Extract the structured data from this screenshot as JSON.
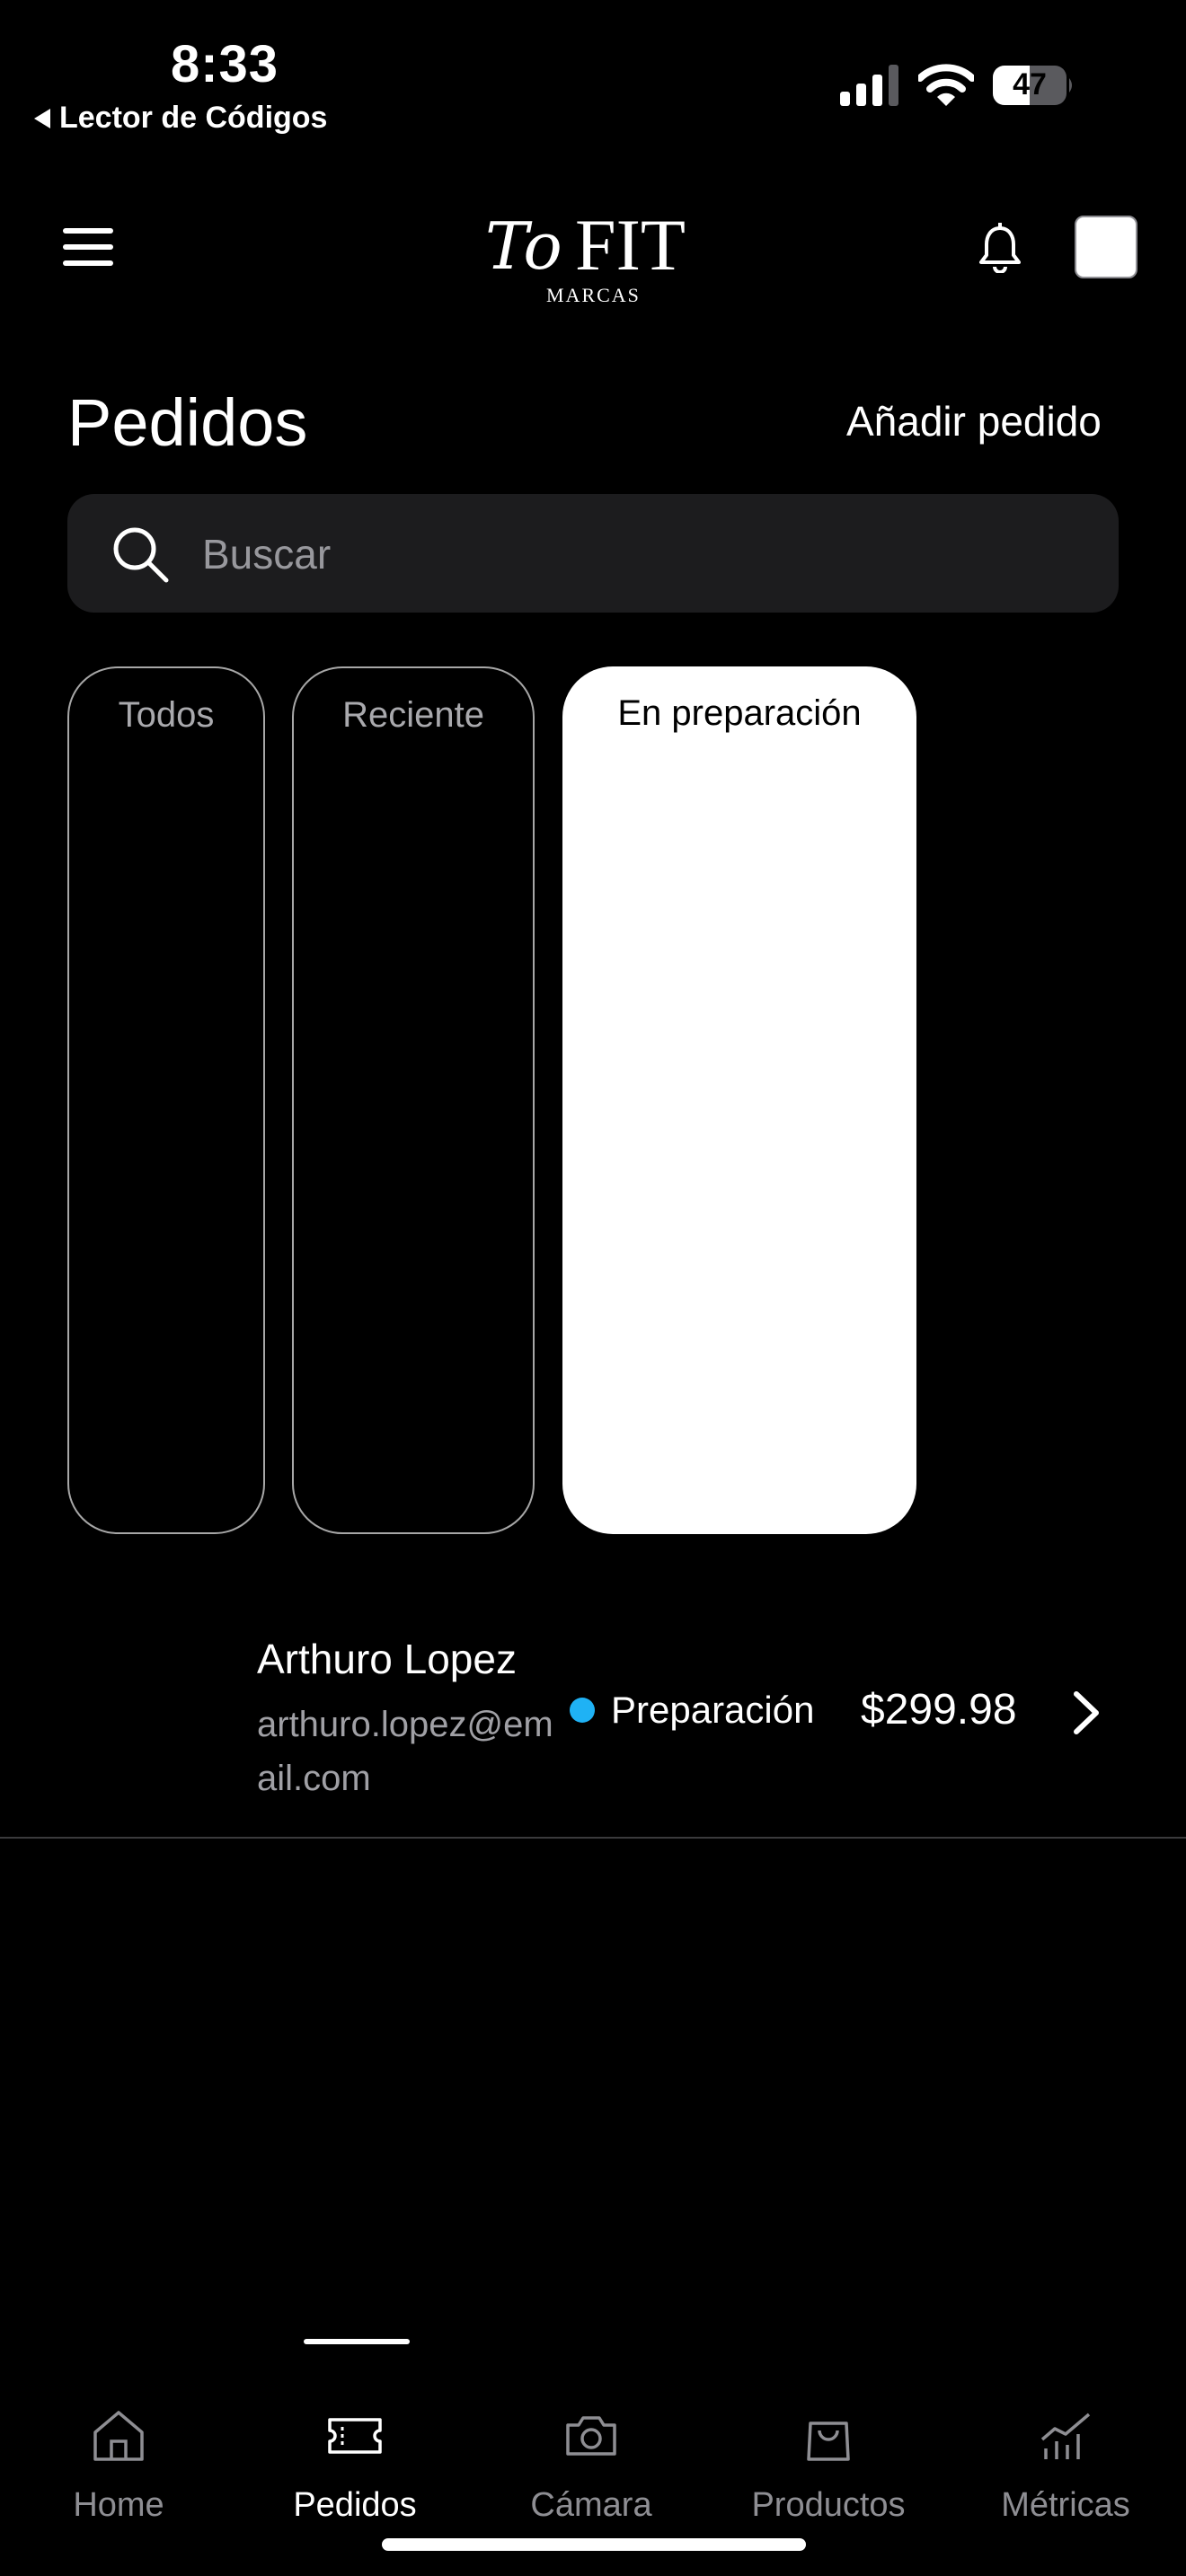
{
  "status_bar": {
    "time": "8:33",
    "back_app": "Lector de Códigos",
    "battery": "47"
  },
  "header": {
    "logo_script": "To",
    "logo_main": "FIT",
    "logo_sub": "MARCAS"
  },
  "page": {
    "title": "Pedidos",
    "add_action": "Añadir pedido"
  },
  "search": {
    "placeholder": "Buscar"
  },
  "filters": [
    {
      "label": "Todos",
      "active": false
    },
    {
      "label": "Reciente",
      "active": false
    },
    {
      "label": "En preparación",
      "active": true
    }
  ],
  "orders": [
    {
      "name": "Arthuro Lopez",
      "email": "arthuro.lopez@email.com",
      "status": "Preparación",
      "status_color": "#1fb2f5",
      "amount": "$299.98"
    }
  ],
  "tabs": [
    {
      "label": "Home",
      "icon": "home-icon",
      "active": false
    },
    {
      "label": "Pedidos",
      "icon": "ticket-icon",
      "active": true
    },
    {
      "label": "Cámara",
      "icon": "camera-icon",
      "active": false
    },
    {
      "label": "Productos",
      "icon": "shopping-bag-icon",
      "active": false
    },
    {
      "label": "Métricas",
      "icon": "chart-icon",
      "active": false
    }
  ],
  "colors": {
    "background": "#000000",
    "surface": "#1c1c1e",
    "accent": "#1fb2f5",
    "muted": "#8e8e93"
  }
}
